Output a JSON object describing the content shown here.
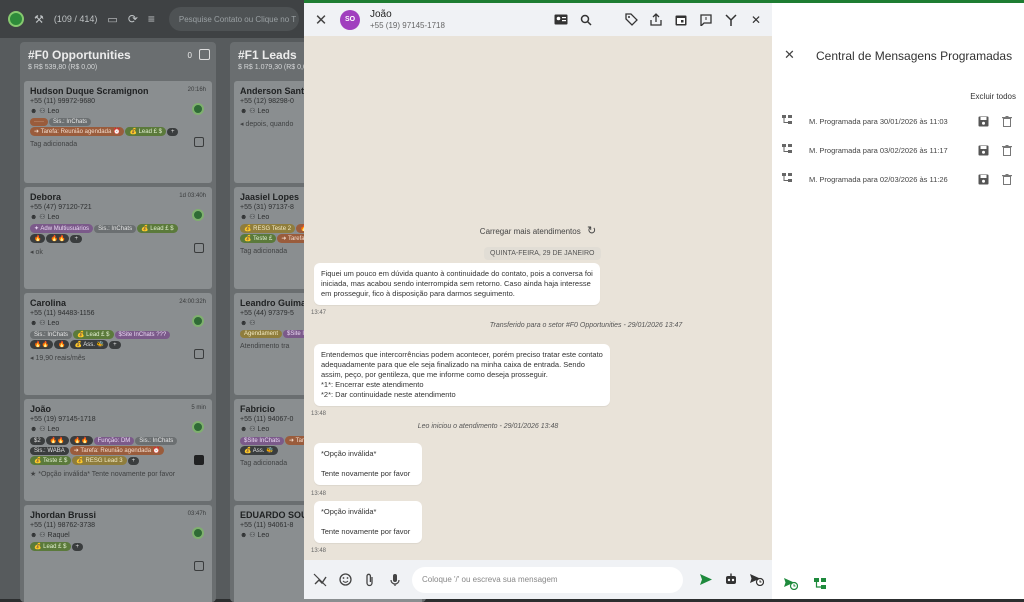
{
  "topbar": {
    "counter": "(109 / 414)",
    "search_placeholder": "Pesquise Contato ou Clique no T"
  },
  "columns": [
    {
      "title": "#F0 Opportunities",
      "count": "0",
      "sub": "$ R$ 539,80 (R$ 0,00)",
      "cards": [
        {
          "name": "Hudson Duque Scramignon",
          "phone": "+55 (11) 99972-9680",
          "user": "Leo",
          "time": "20:16h",
          "chips": [
            [
              "·····",
              "orange"
            ],
            [
              "Sis.: InChats",
              "gray"
            ],
            [
              "➜ Tarefa: Reunião agendada ⏰",
              "orange"
            ],
            [
              "💰 Lead £ $",
              "green"
            ],
            [
              "+",
              "dark"
            ]
          ],
          "footer": "Tag adicionada",
          "checked": false
        },
        {
          "name": "Debora",
          "phone": "+55 (47) 97120-721",
          "user": "Leo",
          "time": "1d 03:40h",
          "chips": [
            [
              "✦ Adw Multiusuários",
              "purple"
            ],
            [
              "Sis.: InChats",
              "gray"
            ],
            [
              "💰 Lead £ $",
              "green"
            ],
            [
              "🔥",
              "dark"
            ],
            [
              "🔥🔥",
              "dark"
            ],
            [
              "+",
              "dark"
            ]
          ],
          "footer": "◂ ok",
          "checked": false
        },
        {
          "name": "Carolina",
          "phone": "+55 (11) 94483-1156",
          "user": "Leo",
          "time": "24:00:32h",
          "chips": [
            [
              "Sis.: InChats",
              "gray"
            ],
            [
              "💰 Lead £ $",
              "green"
            ],
            [
              "$Site InChats ???",
              "purple"
            ],
            [
              "🔥🔥",
              "dark"
            ],
            [
              "🔥",
              "dark"
            ],
            [
              "💰 Ass. 🐝",
              "dark"
            ],
            [
              "+",
              "dark"
            ]
          ],
          "footer": "◂ 19,90 reais/mês",
          "checked": false
        },
        {
          "name": "João",
          "phone": "+55 (19) 97145-1718",
          "user": "Leo",
          "time": "5 min",
          "chips": [
            [
              "$2",
              "dark"
            ],
            [
              "🔥🔥",
              "dark"
            ],
            [
              "🔥🔥",
              "dark"
            ],
            [
              "Função: DM",
              "purple"
            ],
            [
              "Sis.: InChats",
              "gray"
            ],
            [
              "Sis.: WABA",
              "dark"
            ],
            [
              "➜ Tarefa: Reunião agendada ⏰",
              "orange"
            ],
            [
              "💰 Teste £ $",
              "green"
            ],
            [
              "💰 RESG Lead 3",
              "yellow"
            ],
            [
              "+",
              "dark"
            ]
          ],
          "footer": "★ *Opção inválida* Tente novamente por favor",
          "checked": true
        },
        {
          "name": "Jhordan Brussi",
          "phone": "+55 (11) 98762-3738",
          "user": "Raquel",
          "time": "03:47h",
          "chips": [
            [
              "💰 Lead £ $",
              "green"
            ],
            [
              "+",
              "dark"
            ]
          ],
          "footer": "",
          "checked": false
        }
      ]
    },
    {
      "title": "#F1 Leads",
      "count": "",
      "sub": "$ R$ 1.079,30 (R$ 0,00)",
      "cards": [
        {
          "name": "Anderson Santo",
          "phone": "+55 (12) 98298-0",
          "user": "Leo",
          "time": "",
          "chips": [],
          "footer": "◂ depois, quando",
          "checked": false
        },
        {
          "name": "Jaasiel Lopes",
          "phone": "+55 (31) 97137-8",
          "user": "Leo",
          "time": "",
          "chips": [
            [
              "💰 RESG Teste 2",
              "yellow"
            ],
            [
              "🔥🔥🔥🔥",
              "orange"
            ],
            [
              "💰 Teste £",
              "green"
            ],
            [
              "➜ Tarefa: Reuni",
              "orange"
            ],
            [
              "+",
              "dark"
            ]
          ],
          "footer": "Tag adicionada",
          "checked": false
        },
        {
          "name": "Leandro Guima",
          "phone": "+55 (44) 97379-5",
          "user": "",
          "time": "",
          "chips": [
            [
              "Agendament",
              "yellow"
            ],
            [
              "$Site InChats",
              "purple"
            ]
          ],
          "footer": "Atendimento tra",
          "checked": false
        },
        {
          "name": "Fabricio",
          "phone": "+55 (11) 94067-0",
          "user": "Leo",
          "time": "",
          "chips": [
            [
              "$Site InChats",
              "purple"
            ],
            [
              "➜ Tarefa: Reuni",
              "orange"
            ],
            [
              "💰 Ass. 🐝",
              "dark"
            ]
          ],
          "footer": "Tag adicionada",
          "checked": false
        },
        {
          "name": "EDUARDO SOU",
          "phone": "+55 (11) 94061-8",
          "user": "Leo",
          "time": "",
          "chips": [],
          "footer": "",
          "checked": false
        }
      ]
    }
  ],
  "chat": {
    "avatar_initials": "SO",
    "contact_name": "João",
    "contact_phone": "+55 (19) 97145-1718",
    "load_more": "Carregar mais atendimentos",
    "date_badge": "QUINTA-FEIRA, 29 DE JANEIRO",
    "messages": [
      {
        "text": "Fiquei um pouco em dúvida quanto à continuidade do contato, pois a conversa foi iniciada, mas acabou sendo interrompida sem retorno. Caso ainda haja interesse em prosseguir, fico à disposição para darmos seguimento.",
        "time": "13:47"
      },
      {
        "text": "Entendemos que intercorrências podem acontecer, porém preciso tratar este contato adequadamente para que ele seja finalizado na minha caixa de entrada. Sendo assim, peço, por gentileza, que me informe como deseja prosseguir.\n  *1*: Encerrar este atendimento\n  *2*: Dar continuidade neste atendimento",
        "time": "13:48"
      },
      {
        "text": "*Opção inválida*\n\nTente novamente por favor",
        "time": "13:48"
      },
      {
        "text": "*Opção inválida*\n\nTente novamente por favor",
        "time": "13:48"
      }
    ],
    "system": [
      "Transferido para o setor #F0 Opportunities - 29/01/2026 13:47",
      "Leo iniciou o atendimento - 29/01/2026 13:48"
    ],
    "composer_placeholder": "Coloque '/' ou escreva sua mensagem"
  },
  "side": {
    "title": "Central de Mensagens Programadas",
    "delete_all": "Excluir todos",
    "items": [
      {
        "label": "M. Programada para 30/01/2026 às 11:03"
      },
      {
        "label": "M. Programada para 03/02/2026 às 11:17"
      },
      {
        "label": "M. Programada para 02/03/2026 às 11:26"
      }
    ]
  },
  "colors": {
    "accent": "#1e7d32",
    "avatar": "#a03fbe",
    "send": "#1e8a3c"
  }
}
